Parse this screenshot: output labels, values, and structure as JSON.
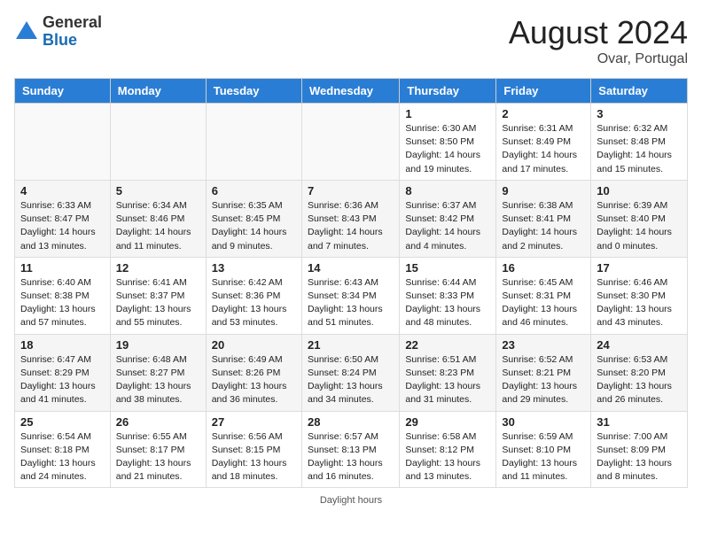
{
  "header": {
    "logo_general": "General",
    "logo_blue": "Blue",
    "month_year": "August 2024",
    "location": "Ovar, Portugal"
  },
  "days_of_week": [
    "Sunday",
    "Monday",
    "Tuesday",
    "Wednesday",
    "Thursday",
    "Friday",
    "Saturday"
  ],
  "weeks": [
    [
      {
        "day": "",
        "info": ""
      },
      {
        "day": "",
        "info": ""
      },
      {
        "day": "",
        "info": ""
      },
      {
        "day": "",
        "info": ""
      },
      {
        "day": "1",
        "info": "Sunrise: 6:30 AM\nSunset: 8:50 PM\nDaylight: 14 hours and 19 minutes."
      },
      {
        "day": "2",
        "info": "Sunrise: 6:31 AM\nSunset: 8:49 PM\nDaylight: 14 hours and 17 minutes."
      },
      {
        "day": "3",
        "info": "Sunrise: 6:32 AM\nSunset: 8:48 PM\nDaylight: 14 hours and 15 minutes."
      }
    ],
    [
      {
        "day": "4",
        "info": "Sunrise: 6:33 AM\nSunset: 8:47 PM\nDaylight: 14 hours and 13 minutes."
      },
      {
        "day": "5",
        "info": "Sunrise: 6:34 AM\nSunset: 8:46 PM\nDaylight: 14 hours and 11 minutes."
      },
      {
        "day": "6",
        "info": "Sunrise: 6:35 AM\nSunset: 8:45 PM\nDaylight: 14 hours and 9 minutes."
      },
      {
        "day": "7",
        "info": "Sunrise: 6:36 AM\nSunset: 8:43 PM\nDaylight: 14 hours and 7 minutes."
      },
      {
        "day": "8",
        "info": "Sunrise: 6:37 AM\nSunset: 8:42 PM\nDaylight: 14 hours and 4 minutes."
      },
      {
        "day": "9",
        "info": "Sunrise: 6:38 AM\nSunset: 8:41 PM\nDaylight: 14 hours and 2 minutes."
      },
      {
        "day": "10",
        "info": "Sunrise: 6:39 AM\nSunset: 8:40 PM\nDaylight: 14 hours and 0 minutes."
      }
    ],
    [
      {
        "day": "11",
        "info": "Sunrise: 6:40 AM\nSunset: 8:38 PM\nDaylight: 13 hours and 57 minutes."
      },
      {
        "day": "12",
        "info": "Sunrise: 6:41 AM\nSunset: 8:37 PM\nDaylight: 13 hours and 55 minutes."
      },
      {
        "day": "13",
        "info": "Sunrise: 6:42 AM\nSunset: 8:36 PM\nDaylight: 13 hours and 53 minutes."
      },
      {
        "day": "14",
        "info": "Sunrise: 6:43 AM\nSunset: 8:34 PM\nDaylight: 13 hours and 51 minutes."
      },
      {
        "day": "15",
        "info": "Sunrise: 6:44 AM\nSunset: 8:33 PM\nDaylight: 13 hours and 48 minutes."
      },
      {
        "day": "16",
        "info": "Sunrise: 6:45 AM\nSunset: 8:31 PM\nDaylight: 13 hours and 46 minutes."
      },
      {
        "day": "17",
        "info": "Sunrise: 6:46 AM\nSunset: 8:30 PM\nDaylight: 13 hours and 43 minutes."
      }
    ],
    [
      {
        "day": "18",
        "info": "Sunrise: 6:47 AM\nSunset: 8:29 PM\nDaylight: 13 hours and 41 minutes."
      },
      {
        "day": "19",
        "info": "Sunrise: 6:48 AM\nSunset: 8:27 PM\nDaylight: 13 hours and 38 minutes."
      },
      {
        "day": "20",
        "info": "Sunrise: 6:49 AM\nSunset: 8:26 PM\nDaylight: 13 hours and 36 minutes."
      },
      {
        "day": "21",
        "info": "Sunrise: 6:50 AM\nSunset: 8:24 PM\nDaylight: 13 hours and 34 minutes."
      },
      {
        "day": "22",
        "info": "Sunrise: 6:51 AM\nSunset: 8:23 PM\nDaylight: 13 hours and 31 minutes."
      },
      {
        "day": "23",
        "info": "Sunrise: 6:52 AM\nSunset: 8:21 PM\nDaylight: 13 hours and 29 minutes."
      },
      {
        "day": "24",
        "info": "Sunrise: 6:53 AM\nSunset: 8:20 PM\nDaylight: 13 hours and 26 minutes."
      }
    ],
    [
      {
        "day": "25",
        "info": "Sunrise: 6:54 AM\nSunset: 8:18 PM\nDaylight: 13 hours and 24 minutes."
      },
      {
        "day": "26",
        "info": "Sunrise: 6:55 AM\nSunset: 8:17 PM\nDaylight: 13 hours and 21 minutes."
      },
      {
        "day": "27",
        "info": "Sunrise: 6:56 AM\nSunset: 8:15 PM\nDaylight: 13 hours and 18 minutes."
      },
      {
        "day": "28",
        "info": "Sunrise: 6:57 AM\nSunset: 8:13 PM\nDaylight: 13 hours and 16 minutes."
      },
      {
        "day": "29",
        "info": "Sunrise: 6:58 AM\nSunset: 8:12 PM\nDaylight: 13 hours and 13 minutes."
      },
      {
        "day": "30",
        "info": "Sunrise: 6:59 AM\nSunset: 8:10 PM\nDaylight: 13 hours and 11 minutes."
      },
      {
        "day": "31",
        "info": "Sunrise: 7:00 AM\nSunset: 8:09 PM\nDaylight: 13 hours and 8 minutes."
      }
    ]
  ],
  "footer": {
    "daylight_hours": "Daylight hours"
  }
}
